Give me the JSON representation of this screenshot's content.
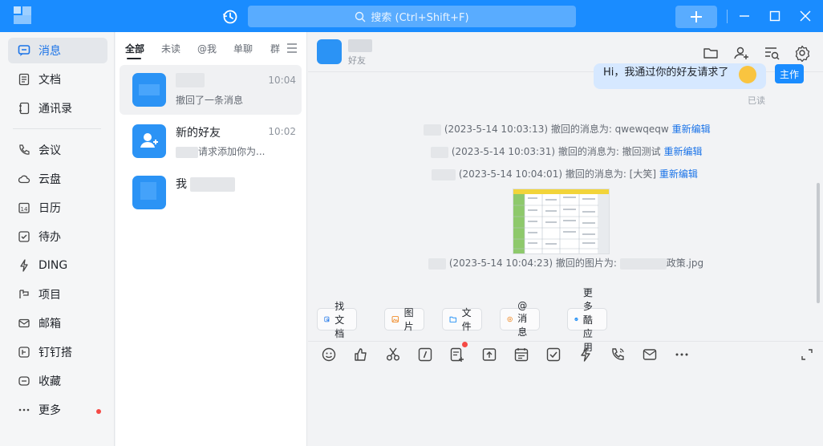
{
  "titlebar": {
    "search_placeholder": "搜索 (Ctrl+Shift+F)",
    "accent": "#1a8cff"
  },
  "sidebar": {
    "items": [
      {
        "label": "消息",
        "icon": "chat-bubble-icon",
        "active": true
      },
      {
        "label": "文档",
        "icon": "document-icon"
      },
      {
        "label": "通讯录",
        "icon": "contacts-icon"
      },
      {
        "label": "会议",
        "icon": "phone-icon"
      },
      {
        "label": "云盘",
        "icon": "cloud-icon"
      },
      {
        "label": "日历",
        "icon": "calendar-icon"
      },
      {
        "label": "待办",
        "icon": "todo-check-icon"
      },
      {
        "label": "DING",
        "icon": "lightning-icon"
      },
      {
        "label": "项目",
        "icon": "project-icon"
      },
      {
        "label": "邮箱",
        "icon": "mail-icon"
      },
      {
        "label": "钉钉搭",
        "icon": "builder-icon"
      },
      {
        "label": "收藏",
        "icon": "favorite-icon"
      },
      {
        "label": "更多",
        "icon": "more-dots-icon",
        "badge": true
      }
    ]
  },
  "conversations": {
    "tabs": [
      "全部",
      "未读",
      "@我",
      "单聊",
      "群"
    ],
    "items": [
      {
        "name": "",
        "time": "10:04",
        "preview": "撤回了一条消息",
        "selected": true
      },
      {
        "name": "新的好友",
        "time": "10:02",
        "preview": "请求添加你为..."
      },
      {
        "name": "我",
        "time": "",
        "preview": ""
      }
    ]
  },
  "chat": {
    "subtitle": "好友",
    "request_text": "Hi，我通过你的好友请求了",
    "accept_label": "主作",
    "read_status": "已读",
    "system_messages": [
      {
        "text": "(2023-5-14 10:03:13) 撤回的消息为: qwewqeqw",
        "action": "重新编辑"
      },
      {
        "text": "(2023-5-14 10:03:31) 撤回的消息为: 撤回测试",
        "action": "重新编辑"
      },
      {
        "text": "(2023-5-14 10:04:01) 撤回的消息为: [大笑]",
        "action": "重新编辑"
      }
    ],
    "image_recall": {
      "text": "(2023-5-14 10:04:23) 撤回的图片为:",
      "filename_suffix": "政策.jpg"
    },
    "quick_actions": [
      {
        "label": "找文档",
        "icon": "find-doc-icon"
      },
      {
        "label": "图片",
        "icon": "image-icon"
      },
      {
        "label": "文件",
        "icon": "folder-icon"
      },
      {
        "label": "@消息",
        "icon": "at-icon"
      },
      {
        "label": "更多酷应用",
        "icon": "apps-icon"
      }
    ],
    "composer_tools": [
      "emoji-icon",
      "like-icon",
      "scissors-icon",
      "slash-icon",
      "add-card-icon",
      "upload-icon",
      "schedule-icon",
      "task-check-icon",
      "ding-lightning-icon",
      "voice-call-icon",
      "mail-icon",
      "more-icon",
      "expand-icon"
    ]
  }
}
